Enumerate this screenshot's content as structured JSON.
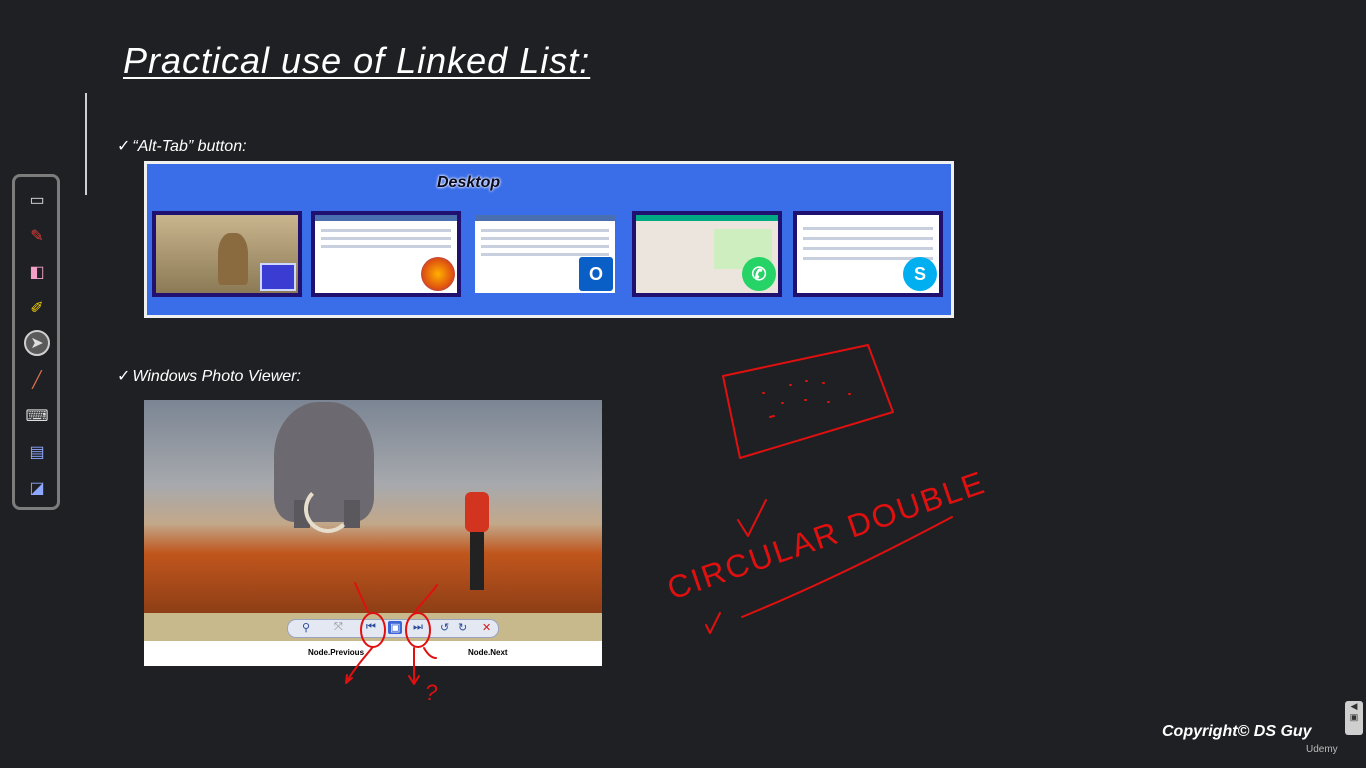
{
  "slide": {
    "title": "Practical use of Linked List:",
    "bullet1": {
      "check": "✓",
      "text": "“Alt-Tab” button:"
    },
    "bullet2": {
      "check": "✓",
      "text": "Windows Photo Viewer:"
    }
  },
  "alttab": {
    "desktop_label": "Desktop",
    "windows": [
      {
        "app": "desktop-wallpaper",
        "icon": "monitor-icon"
      },
      {
        "app": "firefox",
        "icon": "firefox-icon"
      },
      {
        "app": "outlook",
        "icon": "outlook-icon",
        "badge": "O"
      },
      {
        "app": "whatsapp",
        "icon": "whatsapp-icon"
      },
      {
        "app": "skype",
        "icon": "skype-icon",
        "badge": "S"
      }
    ],
    "colors": {
      "background": "#3a6de8",
      "border": "#201070"
    }
  },
  "photo_viewer": {
    "node_previous": "Node.Previous",
    "node_next": "Node.Next",
    "controls": [
      {
        "icon": "zoom-icon",
        "glyph": "⚲"
      },
      {
        "icon": "actual-size-icon",
        "glyph": "⤧"
      },
      {
        "icon": "previous-icon",
        "glyph": "⏮"
      },
      {
        "icon": "slideshow-icon",
        "glyph": "▣"
      },
      {
        "icon": "next-icon",
        "glyph": "⏭"
      },
      {
        "icon": "rotate-left-icon",
        "glyph": "↺"
      },
      {
        "icon": "rotate-right-icon",
        "glyph": "↻"
      },
      {
        "icon": "delete-icon",
        "glyph": "✕"
      }
    ]
  },
  "annotations": {
    "circular_double": "CIRCULAR DOUBLE",
    "question_mark": "?",
    "ink_color": "#e01010"
  },
  "toolbar": {
    "tools": [
      {
        "icon": "whiteboard-icon",
        "glyph": "▭"
      },
      {
        "icon": "pen-icon",
        "glyph": "✎"
      },
      {
        "icon": "eraser-icon",
        "glyph": "◧"
      },
      {
        "icon": "highlighter-icon",
        "glyph": "✐"
      },
      {
        "icon": "pointer-icon",
        "glyph": "➤"
      },
      {
        "icon": "laser-icon",
        "glyph": "╱"
      },
      {
        "icon": "keyboard-icon",
        "glyph": "⌨"
      },
      {
        "icon": "screen-capture-icon",
        "glyph": "▤"
      },
      {
        "icon": "switch-screen-icon",
        "glyph": "◪"
      }
    ],
    "active_tool": "pointer-icon"
  },
  "footer": {
    "copyright": "Copyright© DS Guy",
    "udemy": "Udemy"
  }
}
